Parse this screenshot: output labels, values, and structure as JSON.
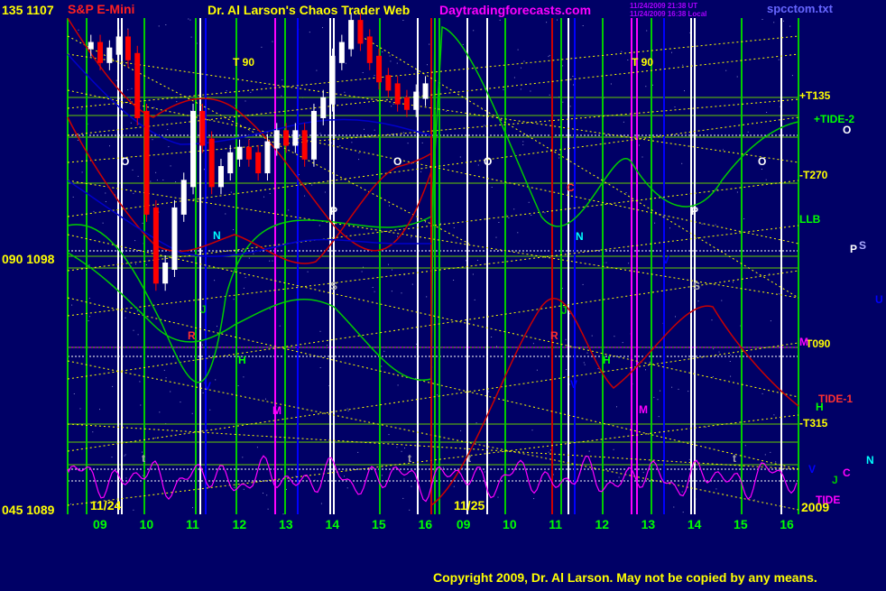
{
  "header": {
    "instrument": "S&P E-Mini",
    "title": "Dr. Al Larson's Chaos Trader Web",
    "site": "Daytradingforecasts.com",
    "timestamp_ut": "11/24/2009 21:38 UT",
    "timestamp_local": "11/24/2009 16:38 Local",
    "filename": "spcctom.txt"
  },
  "footer": {
    "copyright": "Copyright 2009, Dr. Al Larson. May not be copied by any means."
  },
  "colors": {
    "background": "#000066",
    "price_up": "#ffffff",
    "price_down": "#ff0000",
    "vertical_line_white": "#ffffff",
    "vertical_line_green": "#00cc00",
    "vertical_line_magenta": "#ff00ff",
    "vertical_line_red": "#cc0000",
    "vertical_line_blue": "#0000ff",
    "dotted_line": "#ffff00",
    "grid_green": "#66cc00",
    "tide_line": "#00cc00",
    "red_line": "#ff0000",
    "oscillator": "#ff00ff",
    "yellow_text": "#ffff00",
    "green_text": "#00ff00",
    "cyan_text": "#00ffff"
  },
  "chart_data": {
    "type": "line",
    "title": "S&P E-Mini",
    "y_labels": [
      {
        "angle": "135",
        "price": "1107"
      },
      {
        "angle": "090",
        "price": "1098"
      },
      {
        "angle": "045",
        "price": "1089"
      }
    ],
    "ylim": [
      1089,
      1107
    ],
    "x_ticks_day1": [
      "09",
      "10",
      "11",
      "12",
      "13",
      "14",
      "15",
      "16"
    ],
    "x_ticks_day2": [
      "09",
      "10",
      "11",
      "12",
      "13",
      "14",
      "15",
      "16"
    ],
    "date_labels": [
      "11/24",
      "11/25"
    ],
    "year_label": "2009",
    "right_labels": [
      "+T135",
      "+TIDE-2",
      "-T270",
      "LLB",
      "T090",
      "TIDE-1",
      "-T315",
      "TIDE"
    ],
    "planet_glyphs": [
      "O",
      "P",
      "S",
      "U",
      "M",
      "H",
      "J",
      "C",
      "V",
      "N"
    ],
    "time_markers": [
      "T 90",
      "T 90"
    ],
    "marker_letters": [
      "N",
      "J",
      "R",
      "H",
      "V",
      "M",
      "S",
      "P",
      "O",
      "C",
      "t"
    ],
    "price_series": {
      "name": "S&P E-Mini price",
      "x_hours": [
        8.8,
        9.0,
        9.2,
        9.4,
        9.6,
        9.8,
        10.0,
        10.2,
        10.4,
        10.6,
        10.8,
        11.0,
        11.2,
        11.4,
        11.6,
        11.8,
        12.0,
        12.2,
        12.4,
        12.6,
        12.8,
        13.0,
        13.2,
        13.4,
        13.6,
        13.8,
        14.0,
        14.2,
        14.4,
        14.6,
        14.8,
        15.0,
        15.2,
        15.4,
        15.6,
        15.8,
        16.0
      ],
      "values": [
        1106.0,
        1105.5,
        1105.8,
        1106.2,
        1105.6,
        1103.5,
        1100.0,
        1097.5,
        1098.0,
        1100.0,
        1101.0,
        1103.5,
        1102.5,
        1101.0,
        1101.5,
        1102.0,
        1102.2,
        1102.0,
        1101.5,
        1102.4,
        1102.8,
        1102.5,
        1102.8,
        1102.0,
        1103.5,
        1104.0,
        1105.5,
        1106.0,
        1106.8,
        1106.2,
        1105.5,
        1104.8,
        1104.5,
        1104.0,
        1103.8,
        1104.2,
        1104.5
      ]
    },
    "grid": true,
    "legend": "none"
  }
}
